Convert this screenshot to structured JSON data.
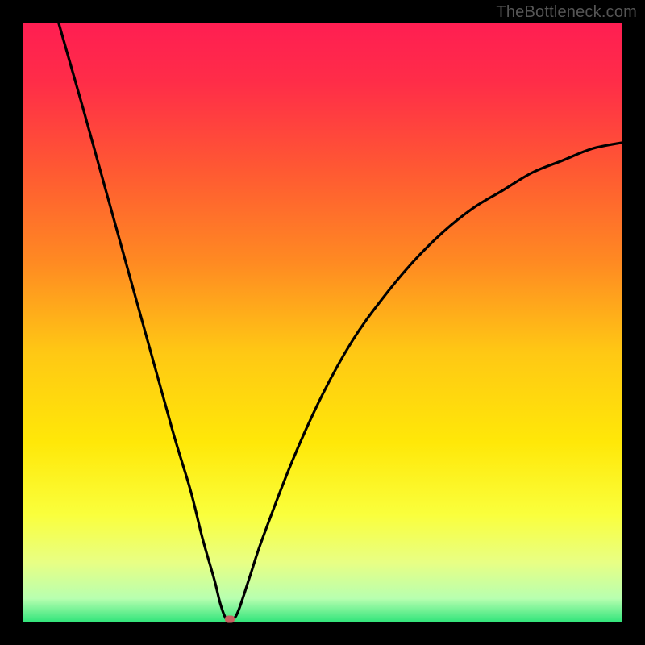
{
  "watermark": "TheBottleneck.com",
  "chart_data": {
    "type": "line",
    "title": "",
    "xlabel": "",
    "ylabel": "",
    "xlim": [
      0,
      100
    ],
    "ylim": [
      0,
      100
    ],
    "curve": {
      "description": "V-shaped bottleneck curve with minimum near x=34",
      "x": [
        6,
        10,
        15,
        20,
        25,
        28,
        30,
        32,
        33,
        34,
        35,
        36,
        38,
        40,
        45,
        50,
        55,
        60,
        65,
        70,
        75,
        80,
        85,
        90,
        95,
        100
      ],
      "y": [
        100,
        86,
        68,
        50,
        32,
        22,
        14,
        7,
        3,
        0.5,
        0.5,
        2,
        8,
        14,
        27,
        38,
        47,
        54,
        60,
        65,
        69,
        72,
        75,
        77,
        79,
        80
      ]
    },
    "marker": {
      "x": 34.5,
      "y": 0.5
    },
    "gradient_stops": [
      {
        "pos": 0.0,
        "color": "#ff1e52"
      },
      {
        "pos": 0.1,
        "color": "#ff2d48"
      },
      {
        "pos": 0.25,
        "color": "#ff5a32"
      },
      {
        "pos": 0.4,
        "color": "#ff8a22"
      },
      {
        "pos": 0.55,
        "color": "#ffc814"
      },
      {
        "pos": 0.7,
        "color": "#ffe808"
      },
      {
        "pos": 0.82,
        "color": "#faff3c"
      },
      {
        "pos": 0.9,
        "color": "#e8ff84"
      },
      {
        "pos": 0.96,
        "color": "#b8ffb0"
      },
      {
        "pos": 1.0,
        "color": "#2fe47a"
      }
    ]
  }
}
